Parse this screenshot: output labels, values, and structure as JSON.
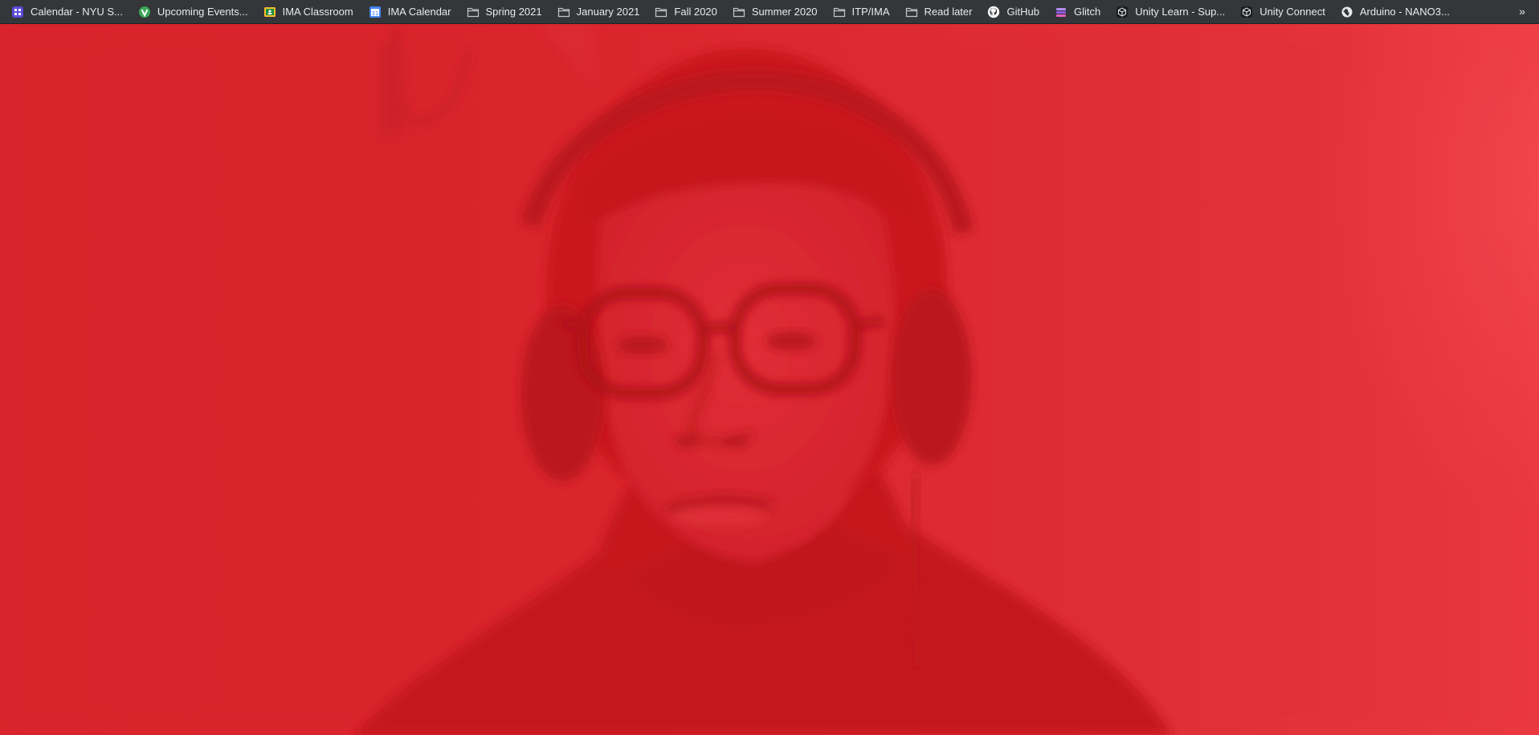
{
  "bookmarks_bar": {
    "items": [
      {
        "label": "Calendar - NYU S...",
        "icon": "calendar-app-icon"
      },
      {
        "label": "Upcoming Events...",
        "icon": "events-app-icon"
      },
      {
        "label": "IMA Classroom",
        "icon": "classroom-icon"
      },
      {
        "label": "IMA Calendar",
        "icon": "google-calendar-icon"
      },
      {
        "label": "Spring 2021",
        "icon": "folder-icon"
      },
      {
        "label": "January 2021",
        "icon": "folder-icon"
      },
      {
        "label": "Fall 2020",
        "icon": "folder-icon"
      },
      {
        "label": "Summer 2020",
        "icon": "folder-icon"
      },
      {
        "label": "ITP/IMA",
        "icon": "folder-icon"
      },
      {
        "label": "Read later",
        "icon": "folder-icon"
      },
      {
        "label": "GitHub",
        "icon": "github-icon"
      },
      {
        "label": "Glitch",
        "icon": "glitch-icon"
      },
      {
        "label": "Unity Learn - Sup...",
        "icon": "unity-icon"
      },
      {
        "label": "Unity Connect",
        "icon": "unity-icon"
      },
      {
        "label": "Arduino - NANO3...",
        "icon": "globe-icon"
      }
    ],
    "overflow_label": "»"
  },
  "colors": {
    "toolbar_bg": "#35363a",
    "toolbar_text": "#e8eaed",
    "video_tint": "#d7232b"
  }
}
